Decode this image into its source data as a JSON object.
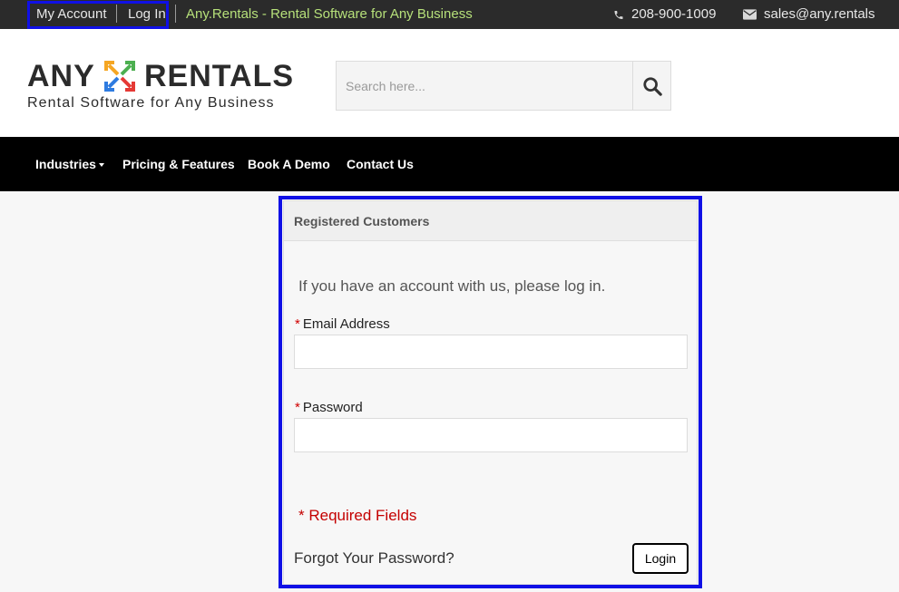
{
  "topbar": {
    "my_account": "My Account",
    "log_in": "Log In",
    "tagline": "Any.Rentals - Rental Software for Any Business",
    "phone": "208-900-1009",
    "email": "sales@any.rentals",
    "phone_icon": "phone-icon",
    "email_icon": "envelope-icon"
  },
  "logo": {
    "word_left": "ANY",
    "word_right": "RENTALS",
    "subtitle": "Rental Software for Any Business",
    "colors": [
      "#f5a623",
      "#4caf50",
      "#2e7be0",
      "#e53935"
    ]
  },
  "search": {
    "placeholder": "Search here...",
    "icon": "search-icon"
  },
  "nav": {
    "items": [
      "Industries",
      "Pricing & Features",
      "Book A Demo",
      "Contact Us"
    ]
  },
  "login": {
    "title": "Registered Customers",
    "intro": "If you have an account with us, please log in.",
    "email_label": "Email Address",
    "email_value": "",
    "password_label": "Password",
    "password_value": "",
    "required_marker": "*",
    "required_note": "* Required Fields",
    "forgot": "Forgot Your Password?",
    "login_button": "Login"
  },
  "colors": {
    "highlight": "#1010e6",
    "topbar_bg": "#2b2b2b",
    "tagline": "#b6e07a",
    "required": "#d00000",
    "nav_bg": "#000000"
  }
}
